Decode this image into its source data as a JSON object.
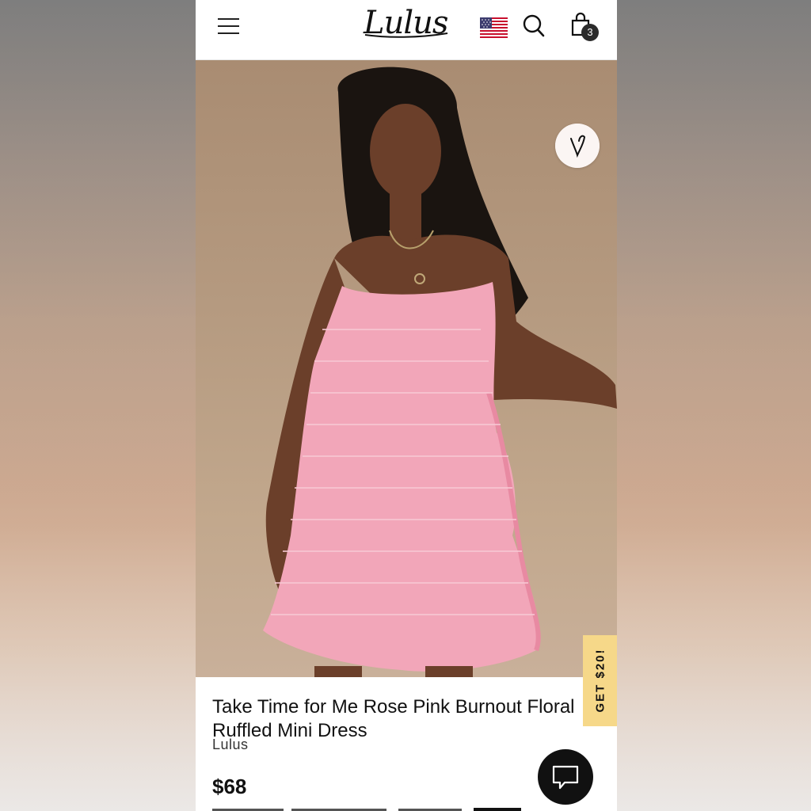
{
  "header": {
    "logo_text": "Lulus",
    "menu_icon": "hamburger-menu-icon",
    "flag_icon": "us-flag-icon",
    "search_icon": "search-icon",
    "bag_icon": "shopping-bag-icon",
    "bag_count": "3"
  },
  "gallery": {
    "image_count": 5,
    "active_index": 0,
    "wishlist_icon": "heart-icon"
  },
  "promo": {
    "label": "GET $20!",
    "color": "#f6d889"
  },
  "product": {
    "title": "Take Time for Me Rose Pink Burnout Floral Ruffled Mini Dress",
    "brand": "Lulus",
    "price": "$68"
  },
  "chat": {
    "icon": "chat-bubble-icon"
  }
}
